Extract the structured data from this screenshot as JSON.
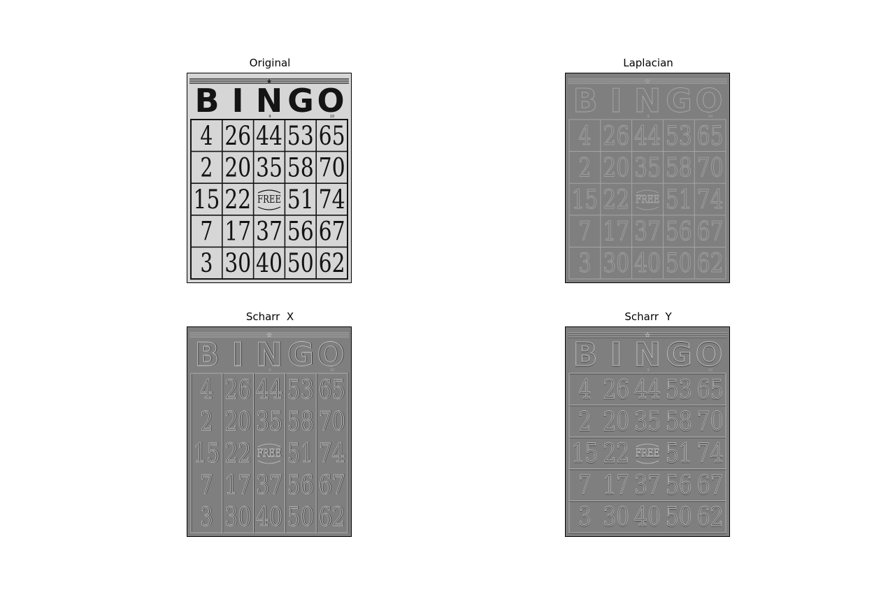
{
  "figure": {
    "panels": [
      {
        "title": "Original",
        "style": "original"
      },
      {
        "title": "Laplacian",
        "style": "laplacian"
      },
      {
        "title": "Scharr  X",
        "style": "scharr-x"
      },
      {
        "title": "Scharr  Y",
        "style": "scharr-y"
      }
    ]
  },
  "bingo_card": {
    "header": "BINGO",
    "header_letters": [
      "B",
      "I",
      "N",
      "G",
      "O"
    ],
    "small_marks": [
      "9",
      "10"
    ],
    "grid": [
      [
        "4",
        "26",
        "44",
        "53",
        "65"
      ],
      [
        "2",
        "20",
        "35",
        "58",
        "70"
      ],
      [
        "15",
        "22",
        "FREE",
        "51",
        "74"
      ],
      [
        "7",
        "17",
        "37",
        "56",
        "67"
      ],
      [
        "3",
        "30",
        "40",
        "50",
        "62"
      ]
    ]
  },
  "colors": {
    "original_bg": "#d6d6d6",
    "original_ink": "#141414",
    "filtered_bg": "#7f7f7f",
    "edge_light": "#c8c8c8",
    "edge_dark": "#3a3a3a"
  }
}
